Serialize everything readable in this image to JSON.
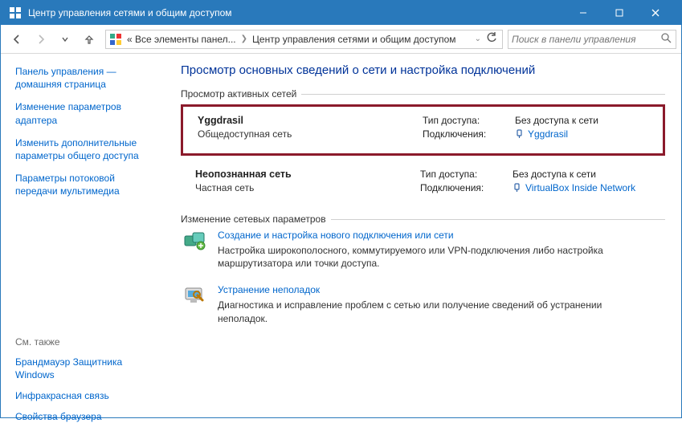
{
  "window": {
    "title": "Центр управления сетями и общим доступом"
  },
  "address": {
    "seg1": "« Все элементы панел...",
    "seg2": "Центр управления сетями и общим доступом"
  },
  "search": {
    "placeholder": "Поиск в панели управления"
  },
  "sidebar": {
    "home": "Панель управления — домашняя страница",
    "adapter": "Изменение параметров адаптера",
    "sharing": "Изменить дополнительные параметры общего доступа",
    "streaming": "Параметры потоковой передачи мультимедиа",
    "seealso_title": "См. также",
    "firewall": "Брандмауэр Защитника Windows",
    "infrared": "Инфракрасная связь",
    "browser": "Свойства браузера"
  },
  "content": {
    "heading": "Просмотр основных сведений о сети и настройка подключений",
    "active_title": "Просмотр активных сетей",
    "change_title": "Изменение сетевых параметров",
    "labels": {
      "access": "Тип доступа:",
      "conn": "Подключения:"
    },
    "net1": {
      "name": "Yggdrasil",
      "type": "Общедоступная сеть",
      "access": "Без доступа к сети",
      "conn": "Yggdrasil"
    },
    "net2": {
      "name": "Неопознанная сеть",
      "type": "Частная сеть",
      "access": "Без доступа к сети",
      "conn": "VirtualBox Inside Network"
    },
    "task1": {
      "title": "Создание и настройка нового подключения или сети",
      "desc": "Настройка широкополосного, коммутируемого или VPN-подключения либо настройка маршрутизатора или точки доступа."
    },
    "task2": {
      "title": "Устранение неполадок",
      "desc": "Диагностика и исправление проблем с сетью или получение сведений об устранении неполадок."
    }
  }
}
